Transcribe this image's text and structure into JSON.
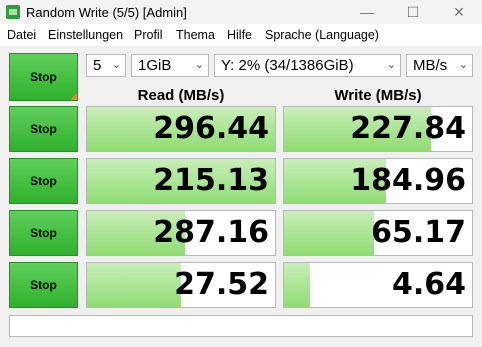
{
  "window": {
    "title": "Random Write (5/5) [Admin]",
    "minimize": "—",
    "maximize": "☐",
    "close": "✕"
  },
  "menu": [
    "Datei",
    "Einstellungen",
    "Profil",
    "Thema",
    "Hilfe",
    "Sprache (Language)"
  ],
  "main_button": {
    "label": "Stop"
  },
  "controls": {
    "count": "5",
    "size": "1GiB",
    "drive": "Y: 2% (34/1386GiB)",
    "unit": "MB/s"
  },
  "headers": {
    "read": "Read (MB/s)",
    "write": "Write (MB/s)"
  },
  "rows": [
    {
      "button": "Stop",
      "read": "296.44",
      "read_fill": 1.0,
      "write": "227.84",
      "write_fill": 0.78
    },
    {
      "button": "Stop",
      "read": "215.13",
      "read_fill": 1.0,
      "write": "184.96",
      "write_fill": 0.54
    },
    {
      "button": "Stop",
      "read": "287.16",
      "read_fill": 0.52,
      "write": "65.17",
      "write_fill": 0.48
    },
    {
      "button": "Stop",
      "read": "27.52",
      "read_fill": 0.5,
      "write": "4.64",
      "write_fill": 0.14
    }
  ],
  "status": "",
  "colors": {
    "accent_green": "#2fb12b",
    "bar_green": "#8fdc74",
    "corner_orange": "#f08a20"
  }
}
